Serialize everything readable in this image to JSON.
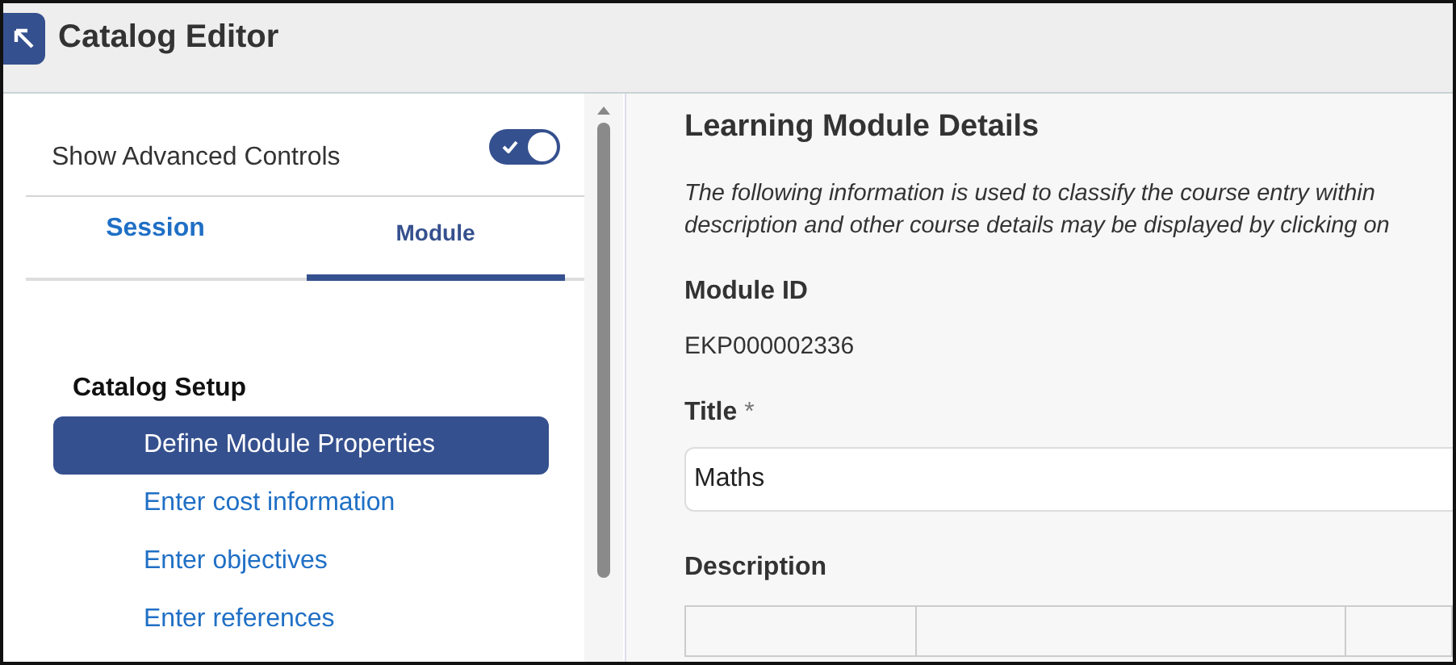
{
  "window": {
    "title": "Catalog Editor"
  },
  "sidebar": {
    "advanced_toggle": {
      "label": "Show Advanced Controls",
      "on": true
    },
    "tabs": [
      {
        "label": "Session",
        "selected": false
      },
      {
        "label": "Module",
        "selected": true
      }
    ],
    "section_title": "Catalog Setup",
    "items": [
      {
        "label": "Define Module Properties",
        "selected": true
      },
      {
        "label": "Enter cost information",
        "selected": false
      },
      {
        "label": "Enter objectives",
        "selected": false
      },
      {
        "label": "Enter references",
        "selected": false
      }
    ]
  },
  "content": {
    "heading": "Learning Module Details",
    "intro_lines": [
      "The following information is used to classify the course entry within",
      "description and other course details may be displayed by clicking on"
    ],
    "module_id": {
      "label": "Module ID",
      "value": "EKP000002336"
    },
    "title_field": {
      "label": "Title",
      "required_mark": "*",
      "value": "Maths"
    },
    "description": {
      "label": "Description"
    }
  }
}
